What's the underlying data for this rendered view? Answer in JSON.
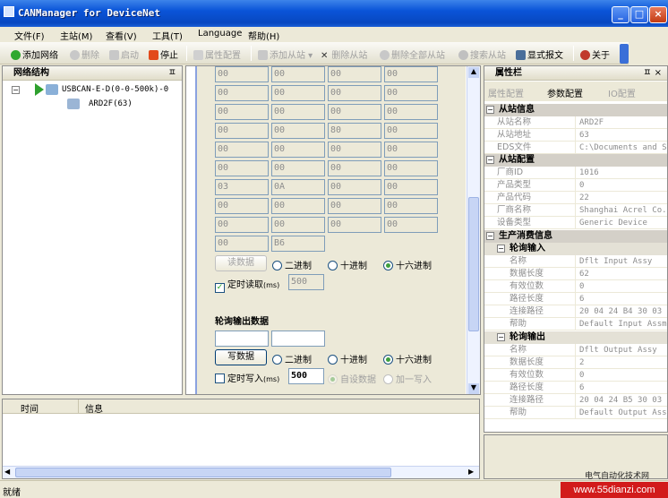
{
  "window": {
    "title": "CANManager for DeviceNet"
  },
  "menu": [
    "文件(F)",
    "主站(M)",
    "查看(V)",
    "工具(T)",
    "Language",
    "帮助(H)"
  ],
  "toolbar": {
    "add_network": "添加网络",
    "delete": "删除",
    "start": "启动",
    "stop": "停止",
    "properties": "属性配置",
    "add_slave": "添加从站",
    "delete_slave": "删除从站",
    "delete_all_slaves": "删除全部从站",
    "search_slave": "搜索从站",
    "show_frames": "显式报文",
    "about": "关于"
  },
  "tree": {
    "title": "网络结构",
    "pin": "ㅍ",
    "network": "USBCAN-E-D(0-0-500k)-0",
    "device": "ARD2F(63)"
  },
  "input_grid": {
    "rows": [
      [
        "00",
        "00",
        "00",
        "00"
      ],
      [
        "00",
        "00",
        "00",
        "00"
      ],
      [
        "00",
        "00",
        "00",
        "00"
      ],
      [
        "00",
        "00",
        "80",
        "00"
      ],
      [
        "00",
        "00",
        "00",
        "00"
      ],
      [
        "00",
        "00",
        "00",
        "00"
      ],
      [
        "03",
        "0A",
        "00",
        "00"
      ],
      [
        "00",
        "00",
        "00",
        "00"
      ],
      [
        "00",
        "00",
        "00",
        "00"
      ],
      [
        "00",
        "B6"
      ]
    ]
  },
  "read": {
    "button": "读数据",
    "binary": "二进制",
    "decimal": "十进制",
    "hex": "十六进制",
    "timed_label": "定时读取",
    "timed_unit": "(ms)",
    "timed_value": "500"
  },
  "output": {
    "section_title": "轮询输出数据",
    "cell1": "",
    "cell2": "",
    "button": "写数据",
    "binary": "二进制",
    "decimal": "十进制",
    "hex": "十六进制",
    "timed_label": "定时写入",
    "timed_unit": "(ms)",
    "timed_value": "500",
    "auto_data": "自设数据",
    "plus_one": "加一写入"
  },
  "properties": {
    "title": "属性栏",
    "pin": "ㅍ ×",
    "tabs": [
      "属性配置",
      "参数配置",
      "IO配置"
    ],
    "sections": [
      {
        "title": "从站信息",
        "rows": [
          [
            "从站名称",
            "ARD2F"
          ],
          [
            "从站地址",
            "63"
          ],
          [
            "EDS文件",
            "C:\\Documents and S"
          ]
        ]
      },
      {
        "title": "从站配置",
        "rows": [
          [
            "厂商ID",
            "1016"
          ],
          [
            "产品类型",
            "0"
          ],
          [
            "产品代码",
            "22"
          ],
          [
            "厂商名称",
            "Shanghai Acrel Co."
          ],
          [
            "设备类型",
            "Generic Device"
          ]
        ]
      }
    ],
    "produce_title": "生产消费信息",
    "poll_input_title": "轮询输入",
    "poll_input_rows": [
      [
        "名称",
        "Dflt Input Assy"
      ],
      [
        "数据长度",
        "62"
      ],
      [
        "有效位数",
        "0"
      ],
      [
        "路径长度",
        "6"
      ],
      [
        "连接路径",
        "20 04 24 B4 30 03"
      ],
      [
        "帮助",
        "Default Input Assm"
      ]
    ],
    "poll_output_title": "轮询输出",
    "poll_output_rows": [
      [
        "名称",
        "Dflt Output Assy"
      ],
      [
        "数据长度",
        "2"
      ],
      [
        "有效位数",
        "0"
      ],
      [
        "路径长度",
        "6"
      ],
      [
        "连接路径",
        "20 04 24 B5 30 03"
      ],
      [
        "帮助",
        "Default Output Ass"
      ]
    ]
  },
  "log": {
    "col_time": "时间",
    "col_info": "信息"
  },
  "status": {
    "text": "就绪"
  },
  "watermark": {
    "line1": "电气自动化技术网",
    "line2": "www.55dianzi.com"
  },
  "colors": {
    "titlebar": "#0a54d8",
    "accent_green": "#3ea03e"
  }
}
